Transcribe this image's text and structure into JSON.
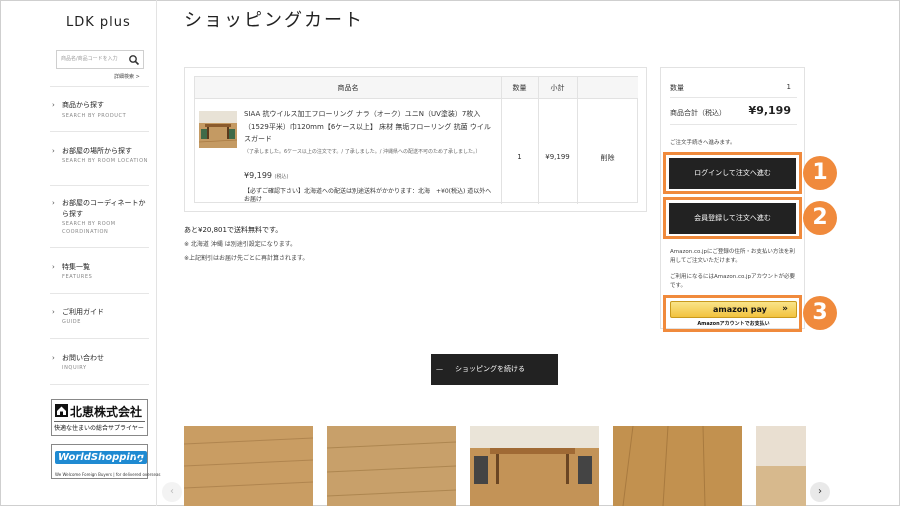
{
  "sidebar": {
    "logo": "LDK plus",
    "search_placeholder": "商品名/商品コードを入力",
    "advanced_search": "詳細検索 >",
    "nav": [
      {
        "jp": "商品から探す",
        "en": "SEARCH BY PRODUCT"
      },
      {
        "jp": "お部屋の場所から探す",
        "en": "SEARCH BY ROOM LOCATION"
      },
      {
        "jp": "お部屋のコーディネートから探す",
        "en": "SEARCH BY ROOM COORDINATION"
      },
      {
        "jp": "特集一覧",
        "en": "FEATURES"
      },
      {
        "jp": "ご利用ガイド",
        "en": "GUIDE"
      },
      {
        "jp": "お問い合わせ",
        "en": "INQUIRY"
      }
    ],
    "banner1": {
      "main": "北恵株式会社",
      "sub": "快適な住まいの総合サプライヤー"
    },
    "banner2": {
      "main": "WorldShopping",
      "sub": "We Welcome Foreign Buyers | for delivered overseas"
    }
  },
  "page_title": "ショッピングカート",
  "cart": {
    "headers": {
      "product": "商品名",
      "qty": "数量",
      "subtotal": "小計"
    },
    "item": {
      "name": "SIAA 抗ウイルス加工フローリング ナラ（オーク）ユニN（UV塗装）7枚入（1529平米）巾120mm【6ケース以上】 床材 無垢フローリング 抗菌 ウイルスガード",
      "note": "（了承しました。6ケース以上の注文です。/ 了承しました。/ 沖縄県への配送不可のため了承しました。）",
      "price": "¥9,199",
      "tax_label": "(税込)",
      "shipping": "【必ずご確認下さい】北海道への配送は別途送料がかかります：北海　+¥0(税込) 道以外へお届け",
      "qty": "1",
      "subtotal": "¥9,199",
      "delete": "削除"
    }
  },
  "free_shipping": "あと¥20,801で送料無料です。",
  "notes": [
    "※ 北海道 沖縄 は別途引設定になります。",
    "※上記割引はお届け先ごとに再計算されます。"
  ],
  "summary": {
    "qty_label": "数量",
    "qty_value": "1",
    "total_label": "商品合計（税込）",
    "total_value": "¥9,199",
    "proceed_text": "ご注文手続きへ進みます。",
    "login_button": "ログインして注文へ進む",
    "register_button": "会員登録して注文へ進む",
    "amazon_text1": "Amazon.co.jpにご登録の住所・お支払い方法を利用してご注文いただけます。",
    "amazon_text2": "ご利用になるにはAmazon.co.jpアカウントが必要です。",
    "amazon_pay_label": "amazon pay",
    "amazon_pay_arrows": "»",
    "amazon_sub": "Amazonアカウントでお支払い"
  },
  "badges": [
    "1",
    "2",
    "3"
  ],
  "continue_button": {
    "dash": "—",
    "label": "ショッピングを続ける"
  },
  "carousel": {
    "prev": "‹",
    "next": "›"
  },
  "colors": {
    "accent": "#f08a3c",
    "dark_button": "#222222",
    "amazon": "#f2c23f"
  }
}
